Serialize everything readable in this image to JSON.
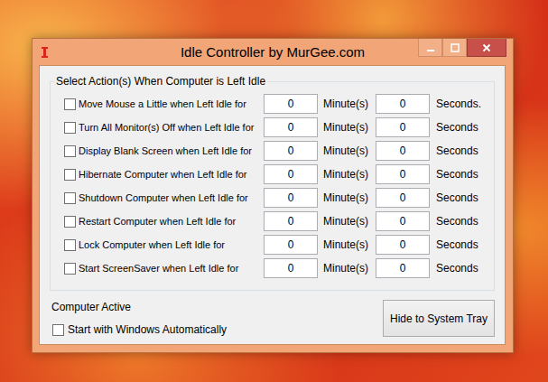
{
  "window": {
    "title": "Idle Controller by MurGee.com"
  },
  "group": {
    "title": "Select Action(s) When Computer is Left Idle"
  },
  "actions": [
    {
      "label": "Move Mouse a Little when Left Idle for",
      "checked": false,
      "minutes": "0",
      "minutes_unit": "Minute(s)",
      "seconds": "0",
      "seconds_unit": "Seconds."
    },
    {
      "label": "Turn All Monitor(s) Off when Left Idle for",
      "checked": false,
      "minutes": "0",
      "minutes_unit": "Minute(s)",
      "seconds": "0",
      "seconds_unit": "Seconds"
    },
    {
      "label": "Display Blank Screen when Left Idle for",
      "checked": false,
      "minutes": "0",
      "minutes_unit": "Minute(s)",
      "seconds": "0",
      "seconds_unit": "Seconds"
    },
    {
      "label": "Hibernate Computer when Left Idle for",
      "checked": false,
      "minutes": "0",
      "minutes_unit": "Minute(s)",
      "seconds": "0",
      "seconds_unit": "Seconds"
    },
    {
      "label": "Shutdown Computer when Left Idle for",
      "checked": false,
      "minutes": "0",
      "minutes_unit": "Minute(s)",
      "seconds": "0",
      "seconds_unit": "Seconds"
    },
    {
      "label": "Restart Computer when Left Idle for",
      "checked": false,
      "minutes": "0",
      "minutes_unit": "Minute(s)",
      "seconds": "0",
      "seconds_unit": "Seconds"
    },
    {
      "label": "Lock Computer when Left Idle for",
      "checked": false,
      "minutes": "0",
      "minutes_unit": "Minute(s)",
      "seconds": "0",
      "seconds_unit": "Seconds"
    },
    {
      "label": "Start ScreenSaver when Left Idle for",
      "checked": false,
      "minutes": "0",
      "minutes_unit": "Minute(s)",
      "seconds": "0",
      "seconds_unit": "Seconds"
    }
  ],
  "status": "Computer Active",
  "startup": {
    "label": "Start with Windows Automatically",
    "checked": false
  },
  "buttons": [
    "Hide to System Tray"
  ]
}
